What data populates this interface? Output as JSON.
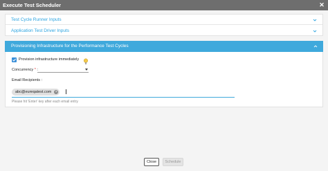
{
  "dialog": {
    "title": "Execute Test Scheduler"
  },
  "sections": {
    "runner": {
      "label": "Test Cycle Runner Inputs"
    },
    "driver": {
      "label": "Application Test Driver Inputs"
    },
    "provisioning": {
      "label": "Provisioning Infrastructure for the Performance Test Cycles"
    }
  },
  "form": {
    "provision_label": "Provision infrastructure immediately",
    "provision_checked": true,
    "concurrency_label": "Concurrency",
    "concurrency_required": "*",
    "concurrency_colon": ":",
    "concurrency_value": "",
    "email_label": "Email Recipients :",
    "email_chips": [
      "abc@eureqatest.com"
    ],
    "email_hint": "Please hit 'Enter' key after each email entry"
  },
  "footer": {
    "close_label": "Close",
    "schedule_label": "Schedule"
  },
  "colors": {
    "accent": "#3fa9dc",
    "link": "#2aa3e0",
    "titlebar": "#6e6e6e"
  },
  "icons": {
    "close": "close-icon",
    "chevron": "chevron-icon",
    "bulb": "lightbulb-icon",
    "check": "checkmark-icon"
  }
}
